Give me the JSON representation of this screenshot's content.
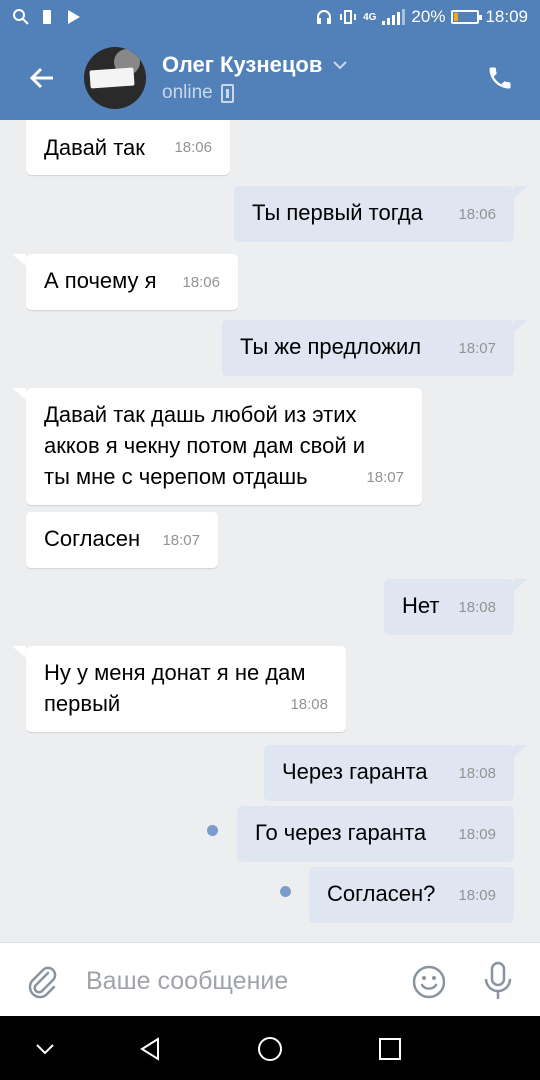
{
  "status_bar": {
    "network": "4G",
    "battery": "20%",
    "battery_level": 0.2,
    "time": "18:09"
  },
  "header": {
    "contact_name": "Олег Кузнецов",
    "status": "online",
    "icons": [
      "back-arrow-icon",
      "chevron-down-icon",
      "mobile-phone-icon",
      "call-icon"
    ]
  },
  "messages": [
    {
      "direction": "in",
      "text": "Давай так",
      "time": "18:06"
    },
    {
      "direction": "out",
      "text": "Ты первый тогда",
      "time": "18:06"
    },
    {
      "direction": "in",
      "text": "А почему я",
      "time": "18:06"
    },
    {
      "direction": "out",
      "text": "Ты же предложил",
      "time": "18:07"
    },
    {
      "direction": "in",
      "lines": [
        "Давай так дашь любой из этих",
        "акков я чекну потом дам свой и",
        "ты мне с черепом отдашь"
      ],
      "time": "18:07"
    },
    {
      "direction": "in",
      "text": "Согласен",
      "time": "18:07"
    },
    {
      "direction": "out",
      "text": "Нет",
      "time": "18:08"
    },
    {
      "direction": "in",
      "lines": [
        "Ну у меня донат я не дам",
        "первый"
      ],
      "time": "18:08"
    },
    {
      "direction": "out",
      "text": "Через гаранта",
      "time": "18:08"
    },
    {
      "direction": "out",
      "text": "Го через гаранта",
      "time": "18:09",
      "unread": true
    },
    {
      "direction": "out",
      "text": "Согласен?",
      "time": "18:09",
      "unread": true
    }
  ],
  "composer": {
    "placeholder": "Ваше сообщение",
    "value": ""
  },
  "colors": {
    "header_bg": "#5181b8",
    "chat_bg": "#edeef0",
    "incoming_bubble": "#ffffff",
    "outgoing_bubble": "#dfe6f2",
    "unread_dot": "#7a9ccb"
  }
}
